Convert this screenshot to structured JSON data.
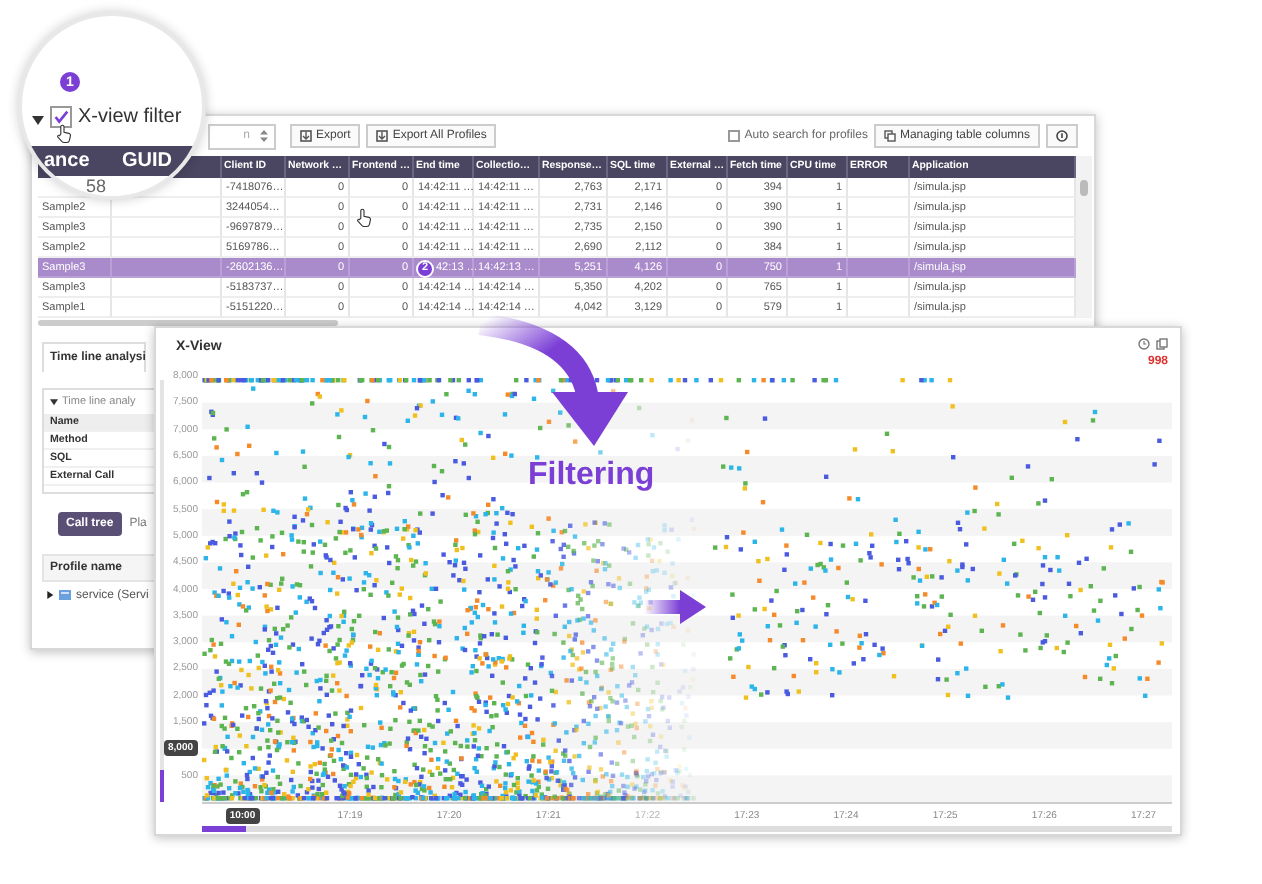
{
  "magnifier": {
    "step_badge": "1",
    "expanded": true,
    "filter": {
      "label": "X-view filter",
      "checked": true
    },
    "column_headers": [
      "ance",
      "GUID"
    ],
    "cell": "58"
  },
  "profiles_window": {
    "toolbar": {
      "dropdown": "n",
      "buttons": [
        "Export",
        "Export All Profiles"
      ],
      "auto_search": {
        "label": "Auto search for profiles",
        "checked": false
      },
      "manage_button": "Managing table columns"
    },
    "table": {
      "columns": [
        {
          "label": "Client ID",
          "kind": "text"
        },
        {
          "label": "Network …",
          "kind": "number"
        },
        {
          "label": "Frontend …",
          "kind": "number"
        },
        {
          "label": "End time",
          "kind": "text"
        },
        {
          "label": "Collectio…",
          "kind": "text"
        },
        {
          "label": "Response…",
          "kind": "number"
        },
        {
          "label": "SQL time",
          "kind": "number"
        },
        {
          "label": "External …",
          "kind": "number"
        },
        {
          "label": "Fetch time",
          "kind": "number"
        },
        {
          "label": "CPU time",
          "kind": "number"
        },
        {
          "label": "ERROR",
          "kind": "text"
        },
        {
          "label": "Application",
          "kind": "text"
        }
      ],
      "rows": [
        {
          "name": null,
          "selected": false,
          "cells": [
            "-7418076…",
            "0",
            "0",
            "14:42:11 …",
            "14:42:11 …",
            "2,763",
            "2,171",
            "0",
            "394",
            "1",
            null,
            "/simula.jsp"
          ]
        },
        {
          "name": "Sample2",
          "selected": false,
          "cells": [
            "3244054…",
            "0",
            "0",
            "14:42:11 …",
            "14:42:11 …",
            "2,731",
            "2,146",
            "0",
            "390",
            "1",
            null,
            "/simula.jsp"
          ]
        },
        {
          "name": "Sample3",
          "selected": false,
          "cells": [
            "-9697879…",
            "0",
            "0",
            "14:42:11 …",
            "14:42:11 …",
            "2,735",
            "2,150",
            "0",
            "390",
            "1",
            null,
            "/simula.jsp"
          ]
        },
        {
          "name": "Sample2",
          "selected": false,
          "cells": [
            "5169786…",
            "0",
            "0",
            "14:42:11 …",
            "14:42:11 …",
            "2,690",
            "2,112",
            "0",
            "384",
            "1",
            null,
            "/simula.jsp"
          ]
        },
        {
          "name": "Sample3",
          "selected": true,
          "step_badge": "2",
          "cells": [
            "-2602136…",
            "0",
            "0",
            "42:13 …",
            "14:42:13 …",
            "5,251",
            "4,126",
            "0",
            "750",
            "1",
            null,
            "/simula.jsp"
          ]
        },
        {
          "name": "Sample3",
          "selected": false,
          "cells": [
            "-5183737…",
            "0",
            "0",
            "14:42:14 …",
            "14:42:14 …",
            "5,350",
            "4,202",
            "0",
            "765",
            "1",
            null,
            "/simula.jsp"
          ]
        },
        {
          "name": "Sample1",
          "selected": false,
          "cells": [
            "-5151220…",
            "0",
            "0",
            "14:42:14 …",
            "14:42:14 …",
            "4,042",
            "3,129",
            "0",
            "579",
            "1",
            null,
            "/simula.jsp"
          ]
        }
      ]
    },
    "tabs": [
      {
        "label": "Time line analysi",
        "selected": true
      }
    ],
    "timeline_panel": {
      "title": "Time line analy",
      "expanded": true,
      "rows": [
        {
          "label": "Name",
          "kind": "header"
        },
        {
          "label": "Method",
          "kind": "row"
        },
        {
          "label": "SQL",
          "kind": "row"
        },
        {
          "label": "External Call",
          "kind": "row"
        }
      ]
    },
    "view_buttons": [
      {
        "label": "Call tree",
        "selected": true
      },
      {
        "label": "Pla",
        "selected": false
      }
    ],
    "profile_header": "Profile name",
    "profile_tree": [
      {
        "label": "service (Servi",
        "expanded": false
      }
    ]
  },
  "xview_window": {
    "title": "X-View",
    "count": "998",
    "y_labels": [
      "8,000",
      "7,500",
      "7,000",
      "6,500",
      "6,000",
      "5,500",
      "5,000",
      "4,500",
      "4,000",
      "3,500",
      "3,000",
      "2,500",
      "2,000",
      "1,500",
      "500"
    ],
    "y_slider": {
      "tag": "8,000",
      "level": 0.075
    },
    "x_labels": [
      {
        "label": "17:19",
        "faded": false
      },
      {
        "label": "17:20",
        "faded": false
      },
      {
        "label": "17:21",
        "faded": false
      },
      {
        "label": "17:22",
        "faded": true
      },
      {
        "label": "17:23",
        "faded": false
      },
      {
        "label": "17:24",
        "faded": false
      },
      {
        "label": "17:25",
        "faded": false
      },
      {
        "label": "17:26",
        "faded": false
      },
      {
        "label": "17:27",
        "faded": false
      }
    ],
    "x_slider": {
      "tag": "10:00",
      "level": 0.045
    }
  },
  "overlay": {
    "label": "Filtering"
  }
}
